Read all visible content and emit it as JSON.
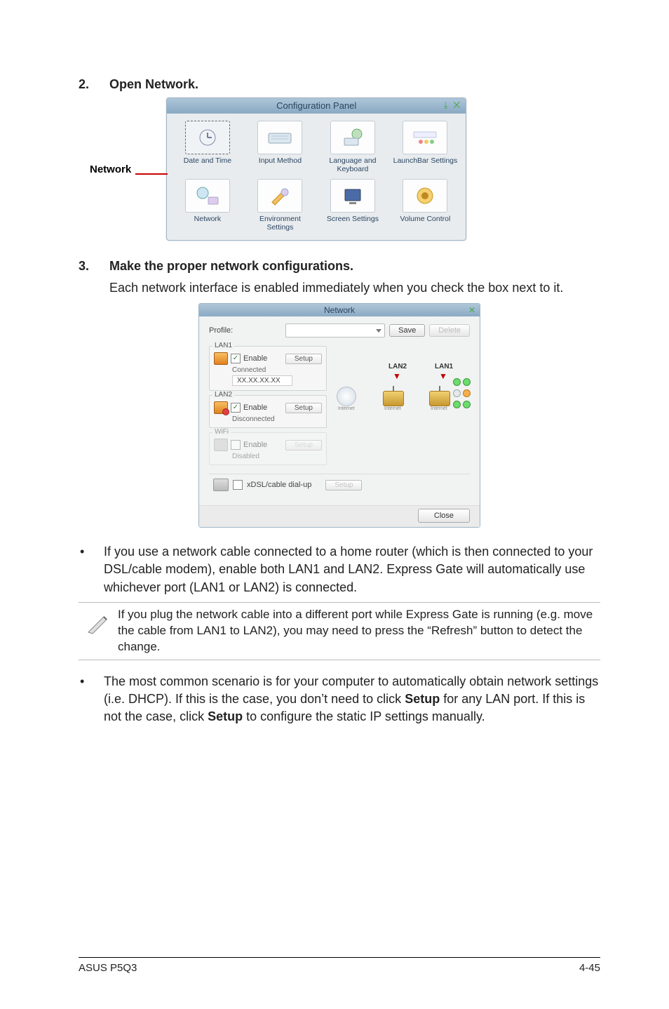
{
  "step2": {
    "num": "2.",
    "title": "Open Network."
  },
  "pointer_label": "Network",
  "config_panel": {
    "title": "Configuration Panel",
    "items": [
      "Date and Time",
      "Input Method",
      "Language and Keyboard",
      "LaunchBar Settings",
      "Network",
      "Environment Settings",
      "Screen Settings",
      "Volume Control"
    ],
    "winbtns": "⤓ ✕"
  },
  "step3": {
    "num": "3.",
    "title": "Make the proper network configurations.",
    "desc": "Each network interface is enabled immediately when you check the box next to it."
  },
  "net_dialog": {
    "title": "Network",
    "profile_label": "Profile:",
    "save": "Save",
    "delete": "Delete",
    "lan1": {
      "label": "LAN1",
      "enable": "Enable",
      "setup": "Setup",
      "status": "Connected",
      "ip": "XX.XX.XX.XX"
    },
    "lan2": {
      "label": "LAN2",
      "enable": "Enable",
      "setup": "Setup",
      "status": "Disconnected"
    },
    "wifi": {
      "label": "WiFi",
      "enable": "Enable",
      "setup": "Setup",
      "status": "Disabled"
    },
    "diagram": {
      "lan2": "LAN2",
      "lan1": "LAN1",
      "internet": "Internet"
    },
    "xdsl": {
      "label": "xDSL/cable dial-up",
      "setup": "Setup"
    },
    "close": "Close"
  },
  "bullet1": "If you use a network cable connected to a home router (which is then connected to your DSL/cable modem), enable both LAN1 and LAN2. Express Gate  will automatically use whichever port (LAN1 or LAN2) is connected.",
  "note1": "If you plug the network cable into a different port while Express Gate  is running (e.g. move the cable from LAN1 to LAN2), you may need to press the “Refresh” button to detect the change.",
  "bullet2_pre": "The most common scenario is for your computer to automatically obtain network settings (i.e. DHCP). If this is the case, you don’t need to click ",
  "bullet2_bold1": "Setup",
  "bullet2_mid": " for any LAN port. If this is not the case, click ",
  "bullet2_bold2": "Setup",
  "bullet2_post": " to configure the static IP settings manually.",
  "footer": {
    "left": "ASUS P5Q3",
    "right": "4-45"
  }
}
